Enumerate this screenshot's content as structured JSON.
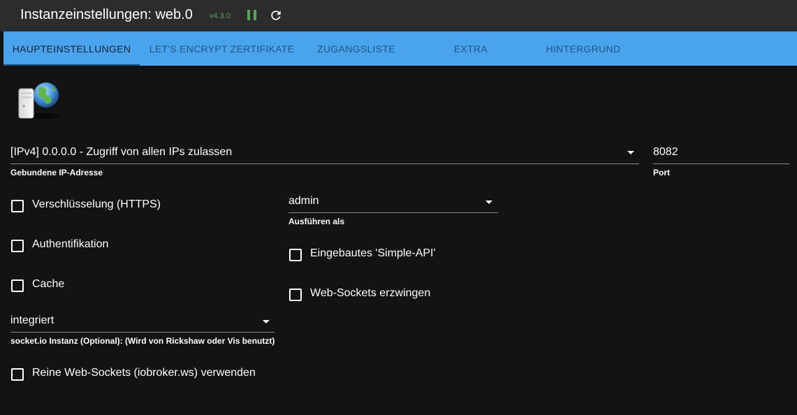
{
  "header": {
    "title": "Instanzeinstellungen: web.0",
    "version": "v4.3.0"
  },
  "tabs": [
    {
      "label": "HAUPTEINSTELLUNGEN",
      "active": true
    },
    {
      "label": "LET'S ENCRYPT ZERTIFIKATE",
      "active": false
    },
    {
      "label": "ZUGANGSLISTE",
      "active": false
    },
    {
      "label": "EXTRA",
      "active": false
    },
    {
      "label": "HINTERGRUND",
      "active": false
    }
  ],
  "form": {
    "bind_ip": {
      "value": "[IPv4] 0.0.0.0 - Zugriff von allen IPs zulassen",
      "label": "Gebundene IP-Adresse"
    },
    "port": {
      "value": "8082",
      "label": "Port"
    },
    "https": {
      "label": "Verschlüsselung (HTTPS)",
      "checked": false
    },
    "run_as": {
      "value": "admin",
      "label": "Ausführen als"
    },
    "auth": {
      "label": "Authentifikation",
      "checked": false
    },
    "simple_api": {
      "label": "Eingebautes 'Simple-API'",
      "checked": false
    },
    "cache": {
      "label": "Cache",
      "checked": false
    },
    "force_websockets": {
      "label": "Web-Sockets erzwingen",
      "checked": false
    },
    "socketio": {
      "value": "integriert",
      "label": "socket.io Instanz (Optional): (Wird von Rickshaw oder Vis benutzt)"
    },
    "pure_websockets": {
      "label": "Reine Web-Sockets (iobroker.ws) verwenden",
      "checked": false
    }
  },
  "colors": {
    "tab_bar": "#4aa3ed",
    "accent_green": "#57a357",
    "background": "#131313",
    "header": "#2c2c2c"
  },
  "icons": {
    "pause": "pause-icon",
    "refresh": "refresh-icon",
    "logo": "server-globe-icon",
    "dropdown": "caret-down-icon"
  }
}
